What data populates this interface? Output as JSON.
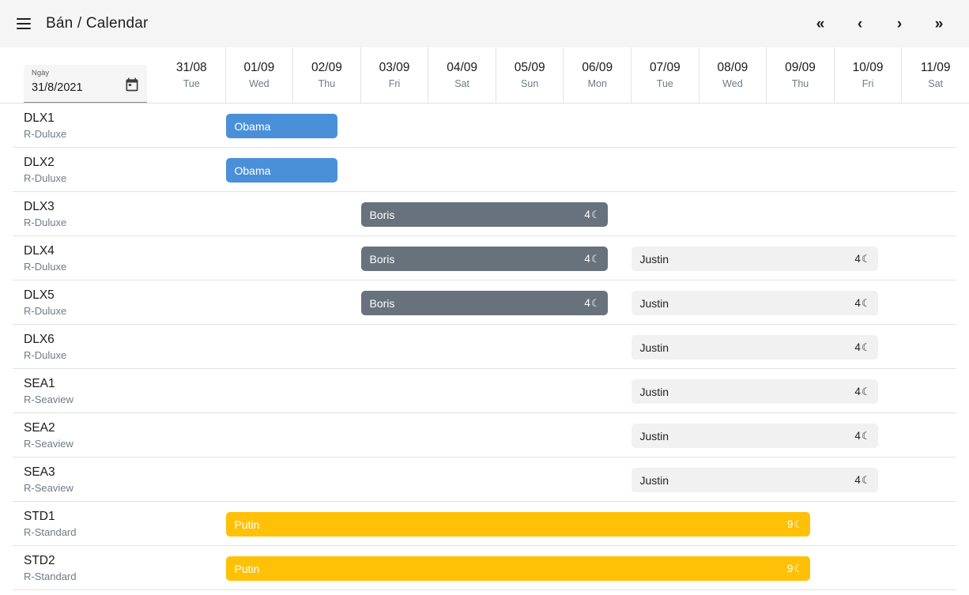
{
  "appbar": {
    "menu_icon": "hamburger-menu-icon",
    "title": "Bán / Calendar",
    "nav": [
      {
        "name": "first",
        "label": "«"
      },
      {
        "name": "previous",
        "label": "‹"
      },
      {
        "name": "next",
        "label": "›"
      },
      {
        "name": "last",
        "label": "»"
      }
    ]
  },
  "date_field": {
    "label": "Ngày",
    "value": "31/8/2021",
    "icon": "calendar-icon"
  },
  "date_columns": [
    {
      "date": "31/08",
      "dow": "Tue"
    },
    {
      "date": "01/09",
      "dow": "Wed"
    },
    {
      "date": "02/09",
      "dow": "Thu"
    },
    {
      "date": "03/09",
      "dow": "Fri"
    },
    {
      "date": "04/09",
      "dow": "Sat"
    },
    {
      "date": "05/09",
      "dow": "Sun"
    },
    {
      "date": "06/09",
      "dow": "Mon"
    },
    {
      "date": "07/09",
      "dow": "Tue"
    },
    {
      "date": "08/09",
      "dow": "Wed"
    },
    {
      "date": "09/09",
      "dow": "Thu"
    },
    {
      "date": "10/09",
      "dow": "Fri"
    },
    {
      "date": "11/09",
      "dow": "Sat"
    }
  ],
  "colors": {
    "blue": "#4a90d9",
    "slate": "#67727c",
    "light": "#f1f1f1",
    "amber": "#ffc107",
    "appbar_bg": "#f5f5f5"
  },
  "rows": [
    {
      "code": "DLX1",
      "type": "R-Duluxe",
      "bookings": [
        {
          "guest": "Obama",
          "nights": "",
          "moon": "",
          "style": "blue",
          "start": 1.0,
          "span": 1.65
        }
      ]
    },
    {
      "code": "DLX2",
      "type": "R-Duluxe",
      "bookings": [
        {
          "guest": "Obama",
          "nights": "",
          "moon": "",
          "style": "blue",
          "start": 1.0,
          "span": 1.65
        }
      ]
    },
    {
      "code": "DLX3",
      "type": "R-Duluxe",
      "bookings": [
        {
          "guest": "Boris",
          "nights": "4",
          "moon": "☾",
          "style": "slate",
          "start": 3.0,
          "span": 3.65
        }
      ]
    },
    {
      "code": "DLX4",
      "type": "R-Duluxe",
      "bookings": [
        {
          "guest": "Boris",
          "nights": "4",
          "moon": "☾",
          "style": "slate",
          "start": 3.0,
          "span": 3.65
        },
        {
          "guest": "Justin",
          "nights": "4",
          "moon": "☾",
          "style": "light",
          "start": 7.0,
          "span": 3.65
        }
      ]
    },
    {
      "code": "DLX5",
      "type": "R-Duluxe",
      "bookings": [
        {
          "guest": "Boris",
          "nights": "4",
          "moon": "☾",
          "style": "slate",
          "start": 3.0,
          "span": 3.65
        },
        {
          "guest": "Justin",
          "nights": "4",
          "moon": "☾",
          "style": "light",
          "start": 7.0,
          "span": 3.65
        }
      ]
    },
    {
      "code": "DLX6",
      "type": "R-Duluxe",
      "bookings": [
        {
          "guest": "Justin",
          "nights": "4",
          "moon": "☾",
          "style": "light",
          "start": 7.0,
          "span": 3.65
        }
      ]
    },
    {
      "code": "SEA1",
      "type": "R-Seaview",
      "bookings": [
        {
          "guest": "Justin",
          "nights": "4",
          "moon": "☾",
          "style": "light",
          "start": 7.0,
          "span": 3.65
        }
      ]
    },
    {
      "code": "SEA2",
      "type": "R-Seaview",
      "bookings": [
        {
          "guest": "Justin",
          "nights": "4",
          "moon": "☾",
          "style": "light",
          "start": 7.0,
          "span": 3.65
        }
      ]
    },
    {
      "code": "SEA3",
      "type": "R-Seaview",
      "bookings": [
        {
          "guest": "Justin",
          "nights": "4",
          "moon": "☾",
          "style": "light",
          "start": 7.0,
          "span": 3.65
        }
      ]
    },
    {
      "code": "STD1",
      "type": "R-Standard",
      "bookings": [
        {
          "guest": "Putin",
          "nights": "9",
          "moon": "☾",
          "style": "amber",
          "start": 1.0,
          "span": 8.65
        }
      ]
    },
    {
      "code": "STD2",
      "type": "R-Standard",
      "bookings": [
        {
          "guest": "Putin",
          "nights": "9",
          "moon": "☾",
          "style": "amber",
          "start": 1.0,
          "span": 8.65
        }
      ]
    }
  ]
}
